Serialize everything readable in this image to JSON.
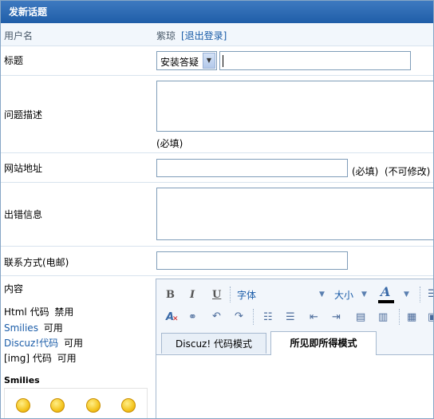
{
  "header": {
    "title": "发新话题"
  },
  "username": {
    "label": "用户名",
    "value": "紫琼",
    "logout_link": "[退出登录]"
  },
  "subject": {
    "label": "标题",
    "category_selected": "安装答疑",
    "value": ""
  },
  "description": {
    "label": "问题描述",
    "required_note": "(必填)"
  },
  "website": {
    "label": "网站地址",
    "required_note": "(必填)",
    "readonly_note": "(不可修改)"
  },
  "error_info": {
    "label": "出错信息"
  },
  "contact": {
    "label": "联系方式(电邮)"
  },
  "content": {
    "label": "内容",
    "html_label": "Html 代码",
    "html_status": "禁用",
    "smilies_label": "Smilies",
    "smilies_status": "可用",
    "discuz_label": "Discuz!代码",
    "discuz_status": "可用",
    "img_label": "[img] 代码",
    "img_status": "可用",
    "smilies_heading": "Smilies"
  },
  "editor": {
    "bold": "B",
    "italic": "I",
    "underline": "U",
    "font_label": "字体",
    "size_label": "大小",
    "color_glyph": "A",
    "tab_code": "Discuz! 代码模式",
    "tab_wysiwyg": "所见即所得模式"
  },
  "smilies": [
    {
      "name": "smile"
    },
    {
      "name": "sad"
    },
    {
      "name": "biggrin"
    },
    {
      "name": "cry"
    }
  ]
}
